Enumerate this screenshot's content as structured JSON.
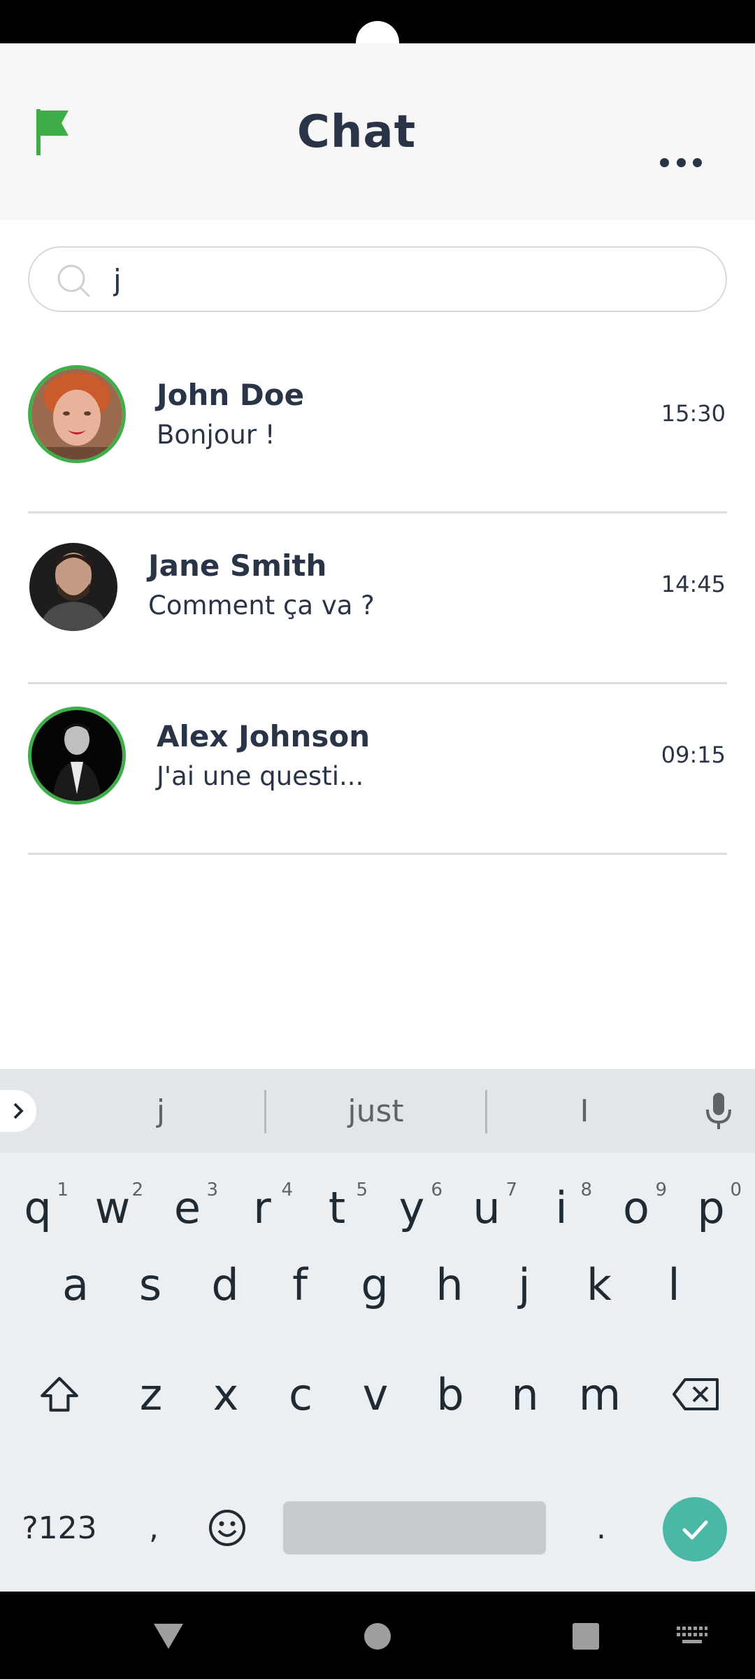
{
  "header": {
    "title": "Chat",
    "flag_icon": "flag-icon",
    "more_icon": "more-horizontal-icon",
    "accent_color": "#3fae49"
  },
  "search": {
    "value": "j",
    "icon": "search-icon"
  },
  "chats": [
    {
      "name": "John Doe",
      "message": "Bonjour !",
      "time": "15:30",
      "ring": true
    },
    {
      "name": "Jane Smith",
      "message": "Comment ça va ?",
      "time": "14:45",
      "ring": false
    },
    {
      "name": "Alex Johnson",
      "message": "J'ai une questi...",
      "time": "09:15",
      "ring": true
    }
  ],
  "keyboard": {
    "suggestions": [
      "j",
      "just",
      "I"
    ],
    "row1": [
      "q",
      "w",
      "e",
      "r",
      "t",
      "y",
      "u",
      "i",
      "o",
      "p"
    ],
    "row1_hints": [
      "1",
      "2",
      "3",
      "4",
      "5",
      "6",
      "7",
      "8",
      "9",
      "0"
    ],
    "row2": [
      "a",
      "s",
      "d",
      "f",
      "g",
      "h",
      "j",
      "k",
      "l"
    ],
    "row3": [
      "z",
      "x",
      "c",
      "v",
      "b",
      "n",
      "m"
    ],
    "symbols_label": "?123",
    "comma": ",",
    "period": ".",
    "enter_color": "#4bb8a7"
  }
}
